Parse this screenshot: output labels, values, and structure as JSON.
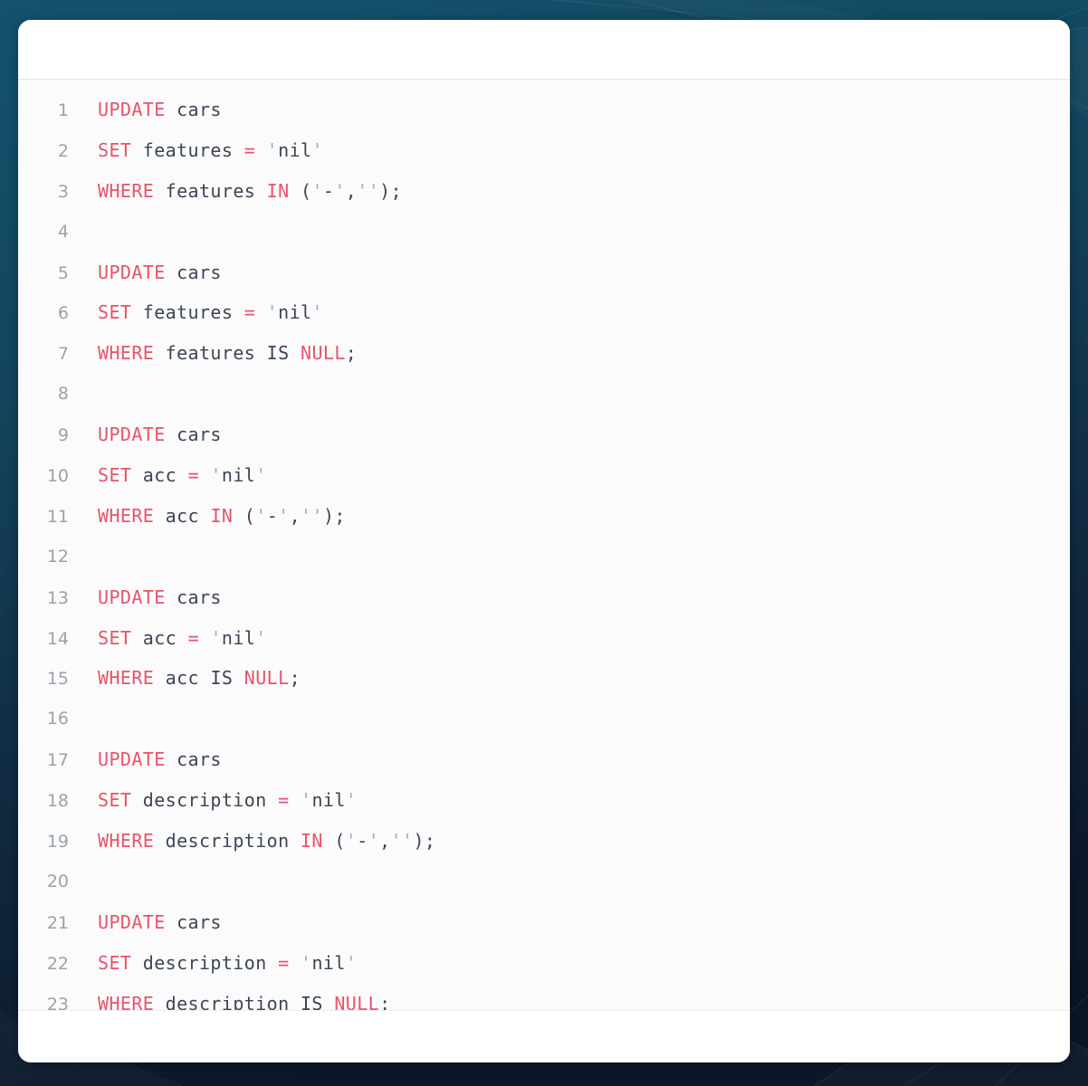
{
  "window": {
    "background_color": "#12374b",
    "card_background": "#ffffff"
  },
  "editor": {
    "language": "sql",
    "gutter_color": "#9aa3ab",
    "keyword_color": "#e8536a",
    "identifier_color": "#3b4654",
    "quote_color": "#9bb0c4",
    "code_background": "#fbfbfb",
    "lines": [
      {
        "number": "1",
        "tokens": [
          {
            "t": "UPDATE",
            "c": "kw"
          },
          {
            "t": " ",
            "c": "punc"
          },
          {
            "t": "cars",
            "c": "id"
          }
        ]
      },
      {
        "number": "2",
        "tokens": [
          {
            "t": "SET",
            "c": "kw"
          },
          {
            "t": " ",
            "c": "punc"
          },
          {
            "t": "features",
            "c": "id"
          },
          {
            "t": " ",
            "c": "punc"
          },
          {
            "t": "=",
            "c": "op"
          },
          {
            "t": " ",
            "c": "punc"
          },
          {
            "t": "'",
            "c": "q"
          },
          {
            "t": "nil",
            "c": "str"
          },
          {
            "t": "'",
            "c": "q"
          }
        ]
      },
      {
        "number": "3",
        "tokens": [
          {
            "t": "WHERE",
            "c": "kw"
          },
          {
            "t": " ",
            "c": "punc"
          },
          {
            "t": "features",
            "c": "id"
          },
          {
            "t": " ",
            "c": "punc"
          },
          {
            "t": "IN",
            "c": "kw"
          },
          {
            "t": " (",
            "c": "punc"
          },
          {
            "t": "'",
            "c": "q"
          },
          {
            "t": "-",
            "c": "str"
          },
          {
            "t": "'",
            "c": "q"
          },
          {
            "t": ",",
            "c": "punc"
          },
          {
            "t": "''",
            "c": "q"
          },
          {
            "t": ");",
            "c": "punc"
          }
        ]
      },
      {
        "number": "4",
        "tokens": []
      },
      {
        "number": "5",
        "tokens": [
          {
            "t": "UPDATE",
            "c": "kw"
          },
          {
            "t": " ",
            "c": "punc"
          },
          {
            "t": "cars",
            "c": "id"
          }
        ]
      },
      {
        "number": "6",
        "tokens": [
          {
            "t": "SET",
            "c": "kw"
          },
          {
            "t": " ",
            "c": "punc"
          },
          {
            "t": "features",
            "c": "id"
          },
          {
            "t": " ",
            "c": "punc"
          },
          {
            "t": "=",
            "c": "op"
          },
          {
            "t": " ",
            "c": "punc"
          },
          {
            "t": "'",
            "c": "q"
          },
          {
            "t": "nil",
            "c": "str"
          },
          {
            "t": "'",
            "c": "q"
          }
        ]
      },
      {
        "number": "7",
        "tokens": [
          {
            "t": "WHERE",
            "c": "kw"
          },
          {
            "t": " ",
            "c": "punc"
          },
          {
            "t": "features",
            "c": "id"
          },
          {
            "t": " ",
            "c": "punc"
          },
          {
            "t": "IS",
            "c": "id"
          },
          {
            "t": " ",
            "c": "punc"
          },
          {
            "t": "NULL",
            "c": "kw"
          },
          {
            "t": ";",
            "c": "punc"
          }
        ]
      },
      {
        "number": "8",
        "tokens": []
      },
      {
        "number": "9",
        "tokens": [
          {
            "t": "UPDATE",
            "c": "kw"
          },
          {
            "t": " ",
            "c": "punc"
          },
          {
            "t": "cars",
            "c": "id"
          }
        ]
      },
      {
        "number": "10",
        "tokens": [
          {
            "t": "SET",
            "c": "kw"
          },
          {
            "t": " ",
            "c": "punc"
          },
          {
            "t": "acc",
            "c": "id"
          },
          {
            "t": " ",
            "c": "punc"
          },
          {
            "t": "=",
            "c": "op"
          },
          {
            "t": " ",
            "c": "punc"
          },
          {
            "t": "'",
            "c": "q"
          },
          {
            "t": "nil",
            "c": "str"
          },
          {
            "t": "'",
            "c": "q"
          }
        ]
      },
      {
        "number": "11",
        "tokens": [
          {
            "t": "WHERE",
            "c": "kw"
          },
          {
            "t": " ",
            "c": "punc"
          },
          {
            "t": "acc",
            "c": "id"
          },
          {
            "t": " ",
            "c": "punc"
          },
          {
            "t": "IN",
            "c": "kw"
          },
          {
            "t": " (",
            "c": "punc"
          },
          {
            "t": "'",
            "c": "q"
          },
          {
            "t": "-",
            "c": "str"
          },
          {
            "t": "'",
            "c": "q"
          },
          {
            "t": ",",
            "c": "punc"
          },
          {
            "t": "''",
            "c": "q"
          },
          {
            "t": ");",
            "c": "punc"
          }
        ]
      },
      {
        "number": "12",
        "tokens": []
      },
      {
        "number": "13",
        "tokens": [
          {
            "t": "UPDATE",
            "c": "kw"
          },
          {
            "t": " ",
            "c": "punc"
          },
          {
            "t": "cars",
            "c": "id"
          }
        ]
      },
      {
        "number": "14",
        "tokens": [
          {
            "t": "SET",
            "c": "kw"
          },
          {
            "t": " ",
            "c": "punc"
          },
          {
            "t": "acc",
            "c": "id"
          },
          {
            "t": " ",
            "c": "punc"
          },
          {
            "t": "=",
            "c": "op"
          },
          {
            "t": " ",
            "c": "punc"
          },
          {
            "t": "'",
            "c": "q"
          },
          {
            "t": "nil",
            "c": "str"
          },
          {
            "t": "'",
            "c": "q"
          }
        ]
      },
      {
        "number": "15",
        "tokens": [
          {
            "t": "WHERE",
            "c": "kw"
          },
          {
            "t": " ",
            "c": "punc"
          },
          {
            "t": "acc",
            "c": "id"
          },
          {
            "t": " ",
            "c": "punc"
          },
          {
            "t": "IS",
            "c": "id"
          },
          {
            "t": " ",
            "c": "punc"
          },
          {
            "t": "NULL",
            "c": "kw"
          },
          {
            "t": ";",
            "c": "punc"
          }
        ]
      },
      {
        "number": "16",
        "tokens": []
      },
      {
        "number": "17",
        "tokens": [
          {
            "t": "UPDATE",
            "c": "kw"
          },
          {
            "t": " ",
            "c": "punc"
          },
          {
            "t": "cars",
            "c": "id"
          }
        ]
      },
      {
        "number": "18",
        "tokens": [
          {
            "t": "SET",
            "c": "kw"
          },
          {
            "t": " ",
            "c": "punc"
          },
          {
            "t": "description",
            "c": "id"
          },
          {
            "t": " ",
            "c": "punc"
          },
          {
            "t": "=",
            "c": "op"
          },
          {
            "t": " ",
            "c": "punc"
          },
          {
            "t": "'",
            "c": "q"
          },
          {
            "t": "nil",
            "c": "str"
          },
          {
            "t": "'",
            "c": "q"
          }
        ]
      },
      {
        "number": "19",
        "tokens": [
          {
            "t": "WHERE",
            "c": "kw"
          },
          {
            "t": " ",
            "c": "punc"
          },
          {
            "t": "description",
            "c": "id"
          },
          {
            "t": " ",
            "c": "punc"
          },
          {
            "t": "IN",
            "c": "kw"
          },
          {
            "t": " (",
            "c": "punc"
          },
          {
            "t": "'",
            "c": "q"
          },
          {
            "t": "-",
            "c": "str"
          },
          {
            "t": "'",
            "c": "q"
          },
          {
            "t": ",",
            "c": "punc"
          },
          {
            "t": "''",
            "c": "q"
          },
          {
            "t": ");",
            "c": "punc"
          }
        ]
      },
      {
        "number": "20",
        "tokens": []
      },
      {
        "number": "21",
        "tokens": [
          {
            "t": "UPDATE",
            "c": "kw"
          },
          {
            "t": " ",
            "c": "punc"
          },
          {
            "t": "cars",
            "c": "id"
          }
        ]
      },
      {
        "number": "22",
        "tokens": [
          {
            "t": "SET",
            "c": "kw"
          },
          {
            "t": " ",
            "c": "punc"
          },
          {
            "t": "description",
            "c": "id"
          },
          {
            "t": " ",
            "c": "punc"
          },
          {
            "t": "=",
            "c": "op"
          },
          {
            "t": " ",
            "c": "punc"
          },
          {
            "t": "'",
            "c": "q"
          },
          {
            "t": "nil",
            "c": "str"
          },
          {
            "t": "'",
            "c": "q"
          }
        ]
      },
      {
        "number": "23",
        "tokens": [
          {
            "t": "WHERE",
            "c": "kw"
          },
          {
            "t": " ",
            "c": "punc"
          },
          {
            "t": "description",
            "c": "id"
          },
          {
            "t": " ",
            "c": "punc"
          },
          {
            "t": "IS",
            "c": "id"
          },
          {
            "t": " ",
            "c": "punc"
          },
          {
            "t": "NULL",
            "c": "kw"
          },
          {
            "t": ";",
            "c": "punc"
          }
        ]
      }
    ]
  }
}
